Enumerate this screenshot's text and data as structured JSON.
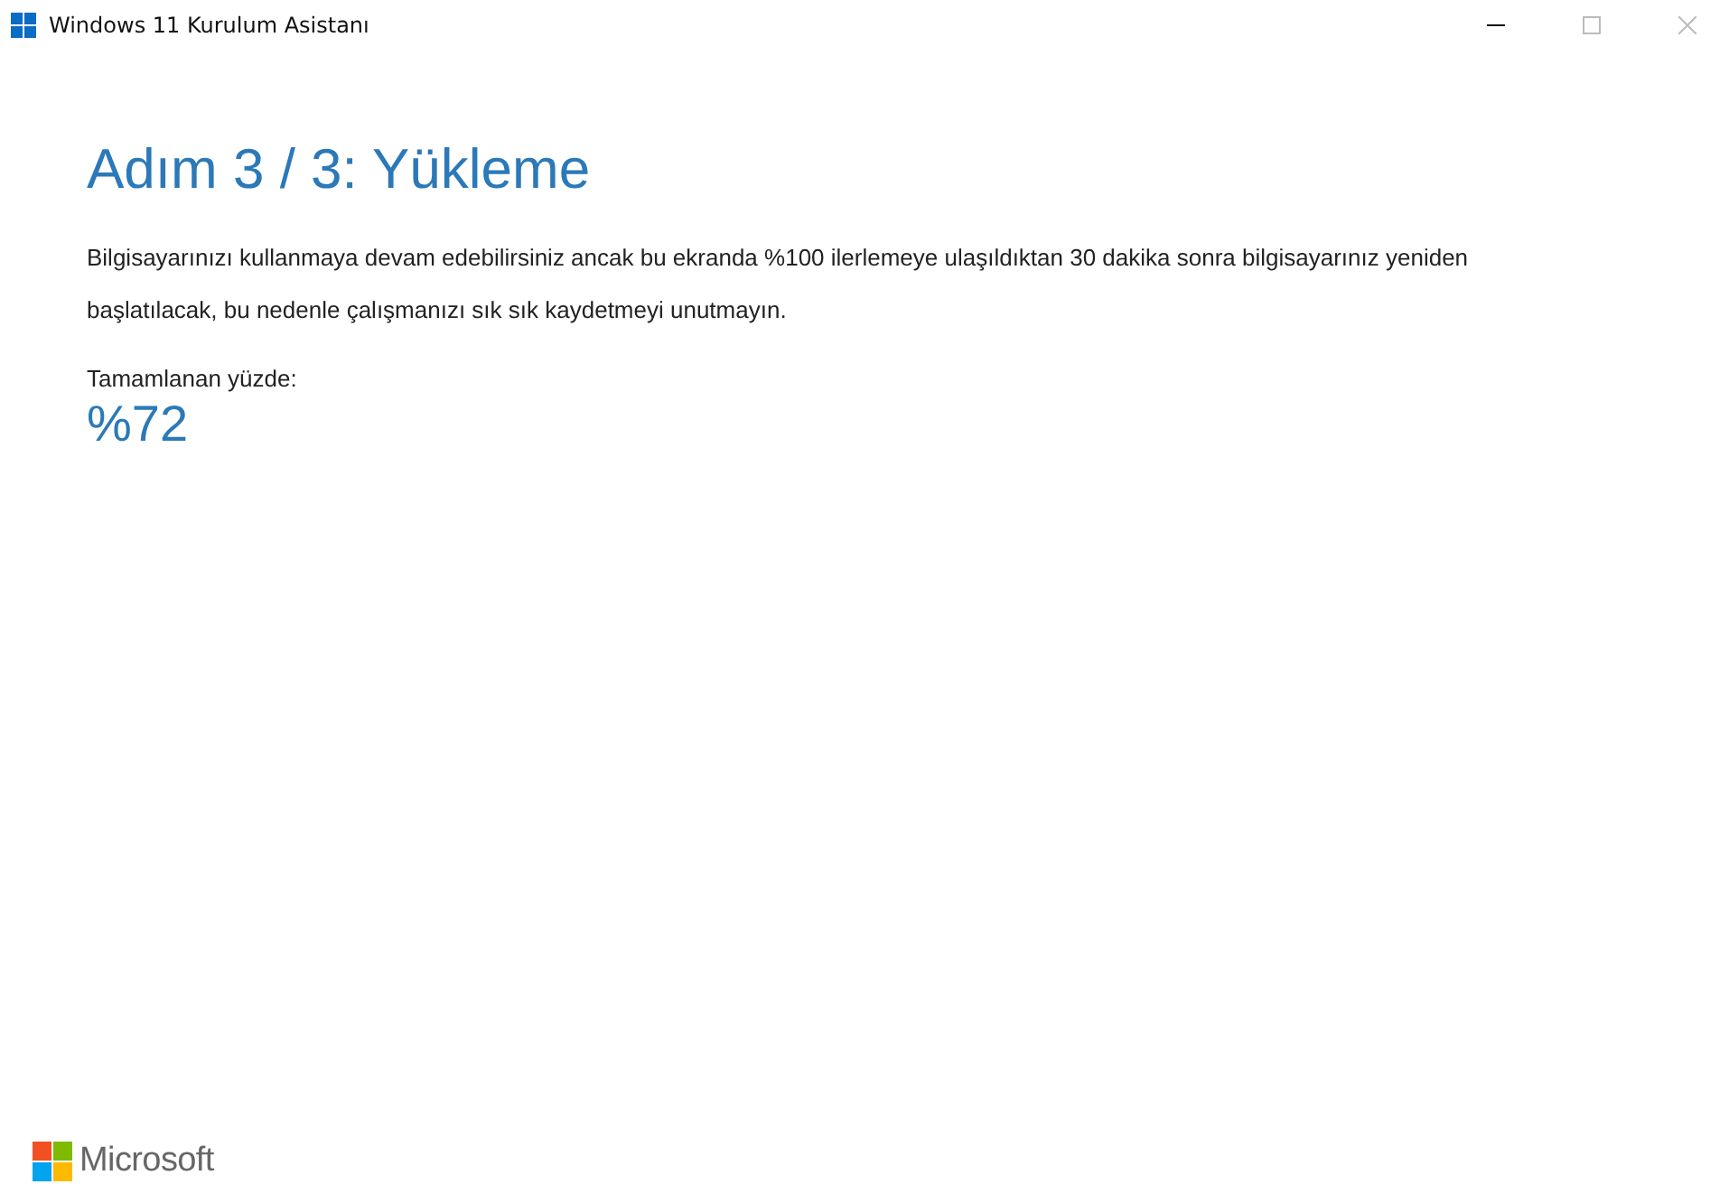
{
  "window": {
    "title": "Windows 11 Kurulum Asistanı"
  },
  "heading": "Adım 3 / 3: Yükleme",
  "description": "Bilgisayarınızı kullanmaya devam edebilirsiniz ancak bu ekranda %100 ilerlemeye ulaşıldıktan 30 dakika sonra bilgisayarınız yeniden başlatılacak, bu nedenle çalışmanızı sık sık kaydetmeyi unutmayın.",
  "progress": {
    "label": "Tamamlanan yüzde:",
    "value": "%72"
  },
  "footer": {
    "brand": "Microsoft"
  }
}
